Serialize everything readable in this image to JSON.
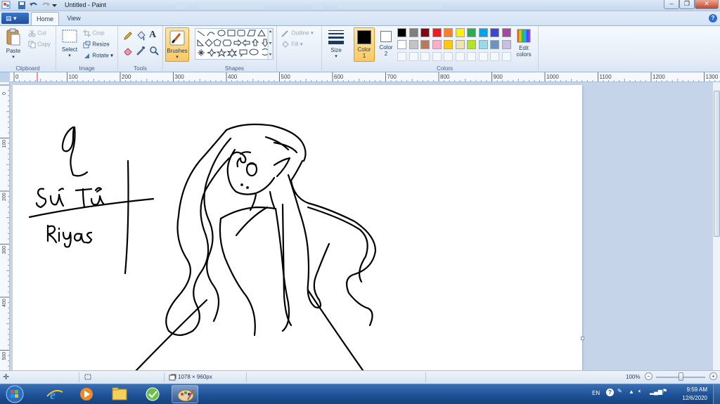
{
  "window": {
    "title": "Untitled - Paint"
  },
  "tabs": {
    "home": "Home",
    "view": "View"
  },
  "ribbon": {
    "clipboard": {
      "label": "Clipboard",
      "paste": "Paste",
      "cut": "Cut",
      "copy": "Copy"
    },
    "image": {
      "label": "Image",
      "select": "Select",
      "crop": "Crop",
      "resize": "Resize",
      "rotate": "Rotate"
    },
    "tools": {
      "label": "Tools",
      "text_tool": "A"
    },
    "brushes": {
      "label": "Brushes"
    },
    "shapes": {
      "label": "Shapes",
      "outline": "Outline",
      "fill": "Fill"
    },
    "size": {
      "label": "Size"
    },
    "colors": {
      "label": "Colors",
      "color1": "Color",
      "color1_num": "1",
      "color2": "Color",
      "color2_num": "2",
      "edit_colors_line1": "Edit",
      "edit_colors_line2": "colors",
      "color1_value": "#000000",
      "color2_value": "#ffffff",
      "palette_row1": [
        "#000000",
        "#7f7f7f",
        "#880015",
        "#ed1c24",
        "#ff7f27",
        "#fff200",
        "#22b14c",
        "#00a2e8",
        "#3f48cc",
        "#a349a4"
      ],
      "palette_row2": [
        "#ffffff",
        "#c3c3c3",
        "#b97a57",
        "#ffaec9",
        "#ffc90e",
        "#efe4b0",
        "#b5e61d",
        "#99d9ea",
        "#7092be",
        "#c8bfe7"
      ]
    }
  },
  "ruler": {
    "h_labels": [
      "0",
      "100",
      "200",
      "300",
      "400",
      "500",
      "600",
      "700",
      "800",
      "900",
      "1000",
      "1100",
      "1200",
      "1300"
    ],
    "v_labels": [
      "0",
      "100",
      "200",
      "300",
      "400",
      "500"
    ]
  },
  "statusbar": {
    "dimensions": "1078 × 960px",
    "zoom": "100%",
    "zoom_minus": "−",
    "zoom_plus": "+"
  },
  "taskbar": {
    "lang": "EN",
    "time": "9:59 AM",
    "date": "12/6/2020"
  },
  "drawing": {
    "texts": [
      "Sư Tử",
      "Riyas"
    ]
  }
}
